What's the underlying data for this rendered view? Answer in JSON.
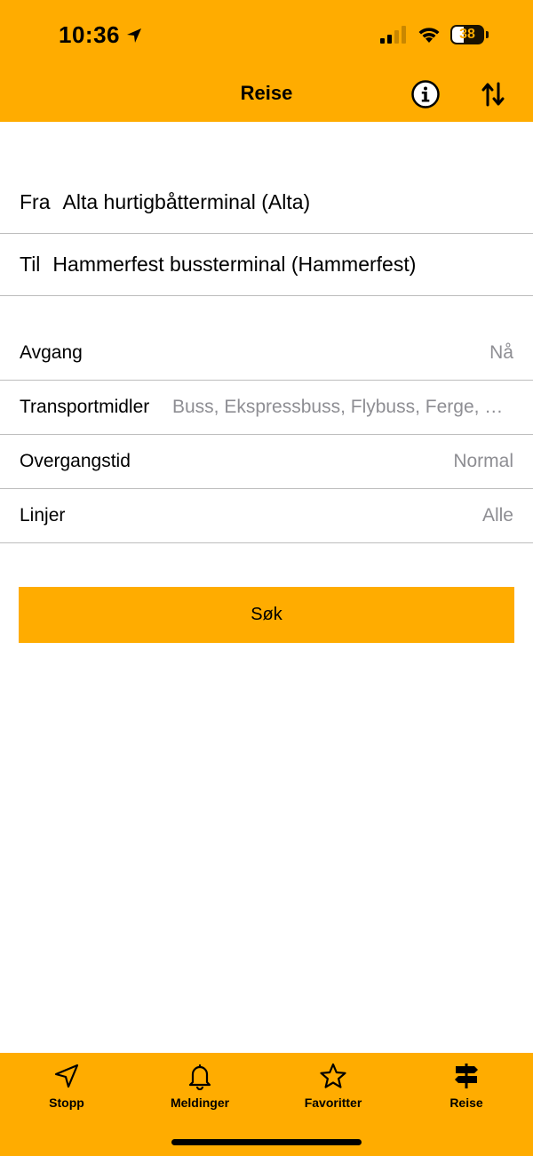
{
  "status_bar": {
    "time": "10:36",
    "battery": "38"
  },
  "nav": {
    "title": "Reise"
  },
  "route": {
    "from_label": "Fra",
    "from_value": "Alta hurtigbåtterminal (Alta)",
    "to_label": "Til",
    "to_value": "Hammerfest bussterminal (Hammerfest)"
  },
  "options": {
    "departure_label": "Avgang",
    "departure_value": "Nå",
    "transport_label": "Transportmidler",
    "transport_value": "Buss, Ekspressbuss, Flybuss, Ferge, Hurtigbåt",
    "transfer_label": "Overgangstid",
    "transfer_value": "Normal",
    "lines_label": "Linjer",
    "lines_value": "Alle"
  },
  "search_button": "Søk",
  "tabs": [
    {
      "label": "Stopp",
      "icon": "navigation-arrow-icon"
    },
    {
      "label": "Meldinger",
      "icon": "bell-icon"
    },
    {
      "label": "Favoritter",
      "icon": "star-icon"
    },
    {
      "label": "Reise",
      "icon": "signpost-icon"
    }
  ],
  "colors": {
    "accent": "#FFAC00",
    "secondary_text": "#8e8e93",
    "divider": "#bdbdbd"
  }
}
